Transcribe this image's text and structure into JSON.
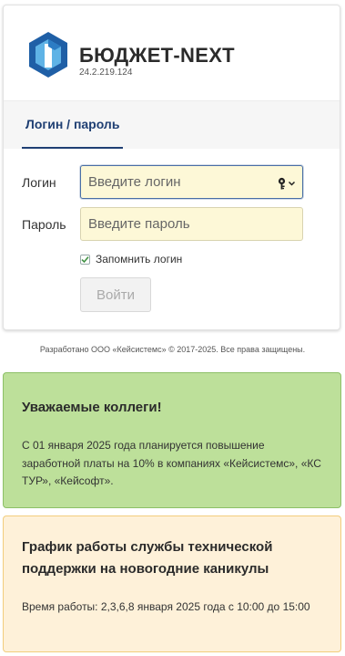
{
  "brand": {
    "name": "БЮДЖЕТ-NEXT",
    "version": "24.2.219.124",
    "colors": {
      "logo_dark": "#1f5fa6",
      "logo_light": "#5fb3e6",
      "accent": "#1f3f73"
    }
  },
  "tabs": [
    {
      "label": "Логин / пароль",
      "active": true
    }
  ],
  "form": {
    "login": {
      "label": "Логин",
      "placeholder": "Введите логин",
      "value": "",
      "icon": "key-icon"
    },
    "password": {
      "label": "Пароль",
      "placeholder": "Введите пароль",
      "value": ""
    },
    "remember": {
      "label": "Запомнить логин",
      "checked": true
    },
    "submit": {
      "label": "Войти",
      "enabled": false
    }
  },
  "footer": {
    "copyright": "Разработано ООО «Кейсистемс» © 2017-2025. Все права защищены."
  },
  "notices": [
    {
      "title": "Уважаемые коллеги!",
      "text": "С 01 января 2025 года планируется повышение заработной платы на 10% в компаниях «Кейсистемс», «КС ТУР», «Кейсофт».",
      "color": "#bde09a"
    },
    {
      "title": "График работы службы технической поддержки на новогодние каникулы",
      "text": "Время работы: 2,3,6,8 января 2025 года с 10:00 до 15:00",
      "color": "#fef1d9"
    }
  ]
}
